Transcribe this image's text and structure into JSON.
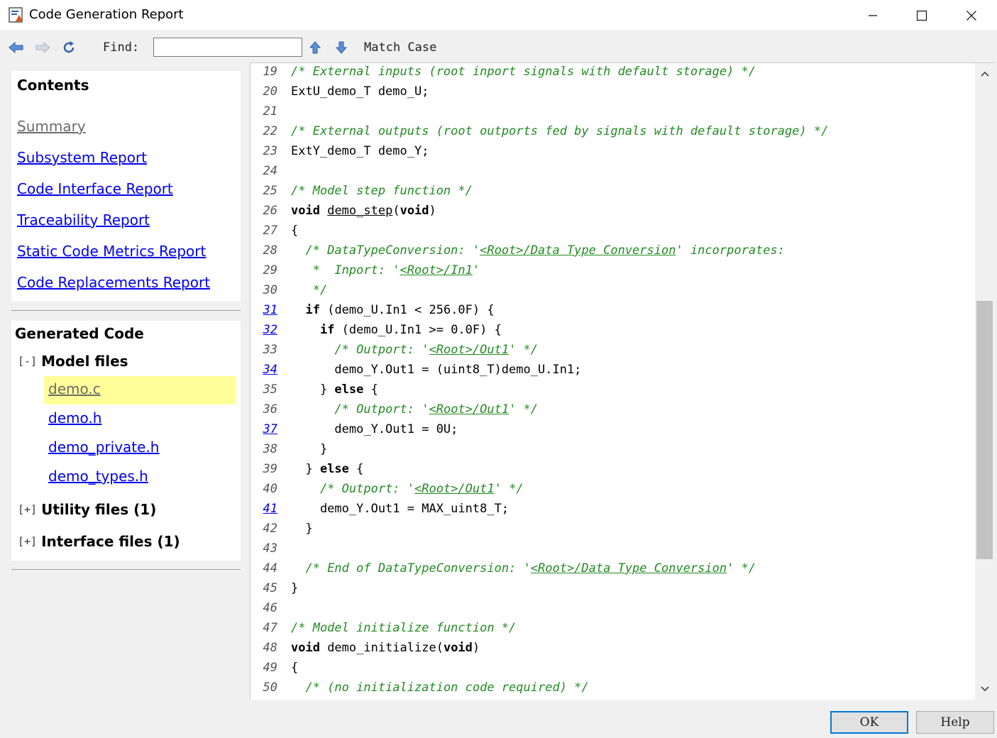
{
  "window": {
    "title": "Code Generation Report"
  },
  "toolbar": {
    "find_label": "Find:",
    "find_value": "",
    "match_case_label": "Match Case"
  },
  "contents": {
    "title": "Contents",
    "links": [
      {
        "label": "Summary",
        "visited": true
      },
      {
        "label": "Subsystem Report",
        "visited": false
      },
      {
        "label": "Code Interface Report",
        "visited": false
      },
      {
        "label": "Traceability Report",
        "visited": false
      },
      {
        "label": "Static Code Metrics Report",
        "visited": false
      },
      {
        "label": "Code Replacements Report",
        "visited": false
      }
    ]
  },
  "generated_code": {
    "title": "Generated Code",
    "groups": [
      {
        "toggle": "[-]",
        "label": "Model files",
        "files": [
          "demo.c",
          "demo.h",
          "demo_private.h",
          "demo_types.h"
        ],
        "selected_file": "demo.c"
      },
      {
        "toggle": "[+]",
        "label": "Utility files (1)",
        "files": []
      },
      {
        "toggle": "[+]",
        "label": "Interface files (1)",
        "files": []
      }
    ]
  },
  "code": {
    "file": "demo.c",
    "lines": [
      {
        "n": "19",
        "link": false,
        "parts": [
          [
            "c",
            "/* External inputs (root inport signals with default storage) */"
          ]
        ]
      },
      {
        "n": "20",
        "link": false,
        "parts": [
          [
            "t",
            "ExtU_demo_T demo_U;"
          ]
        ]
      },
      {
        "n": "21",
        "link": false,
        "parts": []
      },
      {
        "n": "22",
        "link": false,
        "parts": [
          [
            "c",
            "/* External outputs (root outports fed by signals with default storage) */"
          ]
        ]
      },
      {
        "n": "23",
        "link": false,
        "parts": [
          [
            "t",
            "ExtY_demo_T demo_Y;"
          ]
        ]
      },
      {
        "n": "24",
        "link": false,
        "parts": []
      },
      {
        "n": "25",
        "link": false,
        "parts": [
          [
            "c",
            "/* Model step function */"
          ]
        ]
      },
      {
        "n": "26",
        "link": false,
        "parts": [
          [
            "k",
            "void"
          ],
          [
            "t",
            " "
          ],
          [
            "f",
            "demo_step"
          ],
          [
            "t",
            "("
          ],
          [
            "k",
            "void"
          ],
          [
            "t",
            ")"
          ]
        ]
      },
      {
        "n": "27",
        "link": false,
        "parts": [
          [
            "t",
            "{"
          ]
        ]
      },
      {
        "n": "28",
        "link": false,
        "parts": [
          [
            "t",
            "  "
          ],
          [
            "c",
            "/* DataTypeConversion: '"
          ],
          [
            "cl",
            "<Root>/Data Type Conversion"
          ],
          [
            "c",
            "' incorporates:"
          ]
        ]
      },
      {
        "n": "29",
        "link": false,
        "parts": [
          [
            "t",
            "   "
          ],
          [
            "c",
            "*  Inport: '"
          ],
          [
            "cl",
            "<Root>/In1"
          ],
          [
            "c",
            "'"
          ]
        ]
      },
      {
        "n": "30",
        "link": false,
        "parts": [
          [
            "t",
            "   "
          ],
          [
            "c",
            "*/"
          ]
        ]
      },
      {
        "n": "31",
        "link": true,
        "parts": [
          [
            "t",
            "  "
          ],
          [
            "k",
            "if"
          ],
          [
            "t",
            " (demo_U.In1 < 256.0F) {"
          ]
        ]
      },
      {
        "n": "32",
        "link": true,
        "parts": [
          [
            "t",
            "    "
          ],
          [
            "k",
            "if"
          ],
          [
            "t",
            " (demo_U.In1 >= 0.0F) {"
          ]
        ]
      },
      {
        "n": "33",
        "link": false,
        "parts": [
          [
            "t",
            "      "
          ],
          [
            "c",
            "/* Outport: '"
          ],
          [
            "cl",
            "<Root>/Out1"
          ],
          [
            "c",
            "' */"
          ]
        ]
      },
      {
        "n": "34",
        "link": true,
        "parts": [
          [
            "t",
            "      demo_Y.Out1 = (uint8_T)demo_U.In1;"
          ]
        ]
      },
      {
        "n": "35",
        "link": false,
        "parts": [
          [
            "t",
            "    } "
          ],
          [
            "k",
            "else"
          ],
          [
            "t",
            " {"
          ]
        ]
      },
      {
        "n": "36",
        "link": false,
        "parts": [
          [
            "t",
            "      "
          ],
          [
            "c",
            "/* Outport: '"
          ],
          [
            "cl",
            "<Root>/Out1"
          ],
          [
            "c",
            "' */"
          ]
        ]
      },
      {
        "n": "37",
        "link": true,
        "parts": [
          [
            "t",
            "      demo_Y.Out1 = 0U;"
          ]
        ]
      },
      {
        "n": "38",
        "link": false,
        "parts": [
          [
            "t",
            "    }"
          ]
        ]
      },
      {
        "n": "39",
        "link": false,
        "parts": [
          [
            "t",
            "  } "
          ],
          [
            "k",
            "else"
          ],
          [
            "t",
            " {"
          ]
        ]
      },
      {
        "n": "40",
        "link": false,
        "parts": [
          [
            "t",
            "    "
          ],
          [
            "c",
            "/* Outport: '"
          ],
          [
            "cl",
            "<Root>/Out1"
          ],
          [
            "c",
            "' */"
          ]
        ]
      },
      {
        "n": "41",
        "link": true,
        "parts": [
          [
            "t",
            "    demo_Y.Out1 = MAX_uint8_T;"
          ]
        ]
      },
      {
        "n": "42",
        "link": false,
        "parts": [
          [
            "t",
            "  }"
          ]
        ]
      },
      {
        "n": "43",
        "link": false,
        "parts": []
      },
      {
        "n": "44",
        "link": false,
        "parts": [
          [
            "t",
            "  "
          ],
          [
            "c",
            "/* End of DataTypeConversion: '"
          ],
          [
            "cl",
            "<Root>/Data Type Conversion"
          ],
          [
            "c",
            "' */"
          ]
        ]
      },
      {
        "n": "45",
        "link": false,
        "parts": [
          [
            "t",
            "}"
          ]
        ]
      },
      {
        "n": "46",
        "link": false,
        "parts": []
      },
      {
        "n": "47",
        "link": false,
        "parts": [
          [
            "c",
            "/* Model initialize function */"
          ]
        ]
      },
      {
        "n": "48",
        "link": false,
        "parts": [
          [
            "k",
            "void"
          ],
          [
            "t",
            " demo_initialize("
          ],
          [
            "k",
            "void"
          ],
          [
            "t",
            ")"
          ]
        ]
      },
      {
        "n": "49",
        "link": false,
        "parts": [
          [
            "t",
            "{"
          ]
        ]
      },
      {
        "n": "50",
        "link": false,
        "parts": [
          [
            "t",
            "  "
          ],
          [
            "c",
            "/* (no initialization code required) */"
          ]
        ]
      }
    ]
  },
  "scroll": {
    "thumb_start_fraction": 0.363,
    "thumb_size_fraction": 0.437
  },
  "buttons": {
    "ok": "OK",
    "help": "Help"
  },
  "colors": {
    "comment": "#228b22",
    "link": "#0000ee",
    "visited_link": "#6b6b6b",
    "selection_highlight": "#ffff99",
    "scroll_thumb": "#c2c2c2"
  },
  "icons": {
    "app": "matlab-report-icon",
    "back": "back-arrow-icon",
    "forward": "forward-arrow-icon",
    "refresh": "refresh-icon",
    "find_prev": "arrow-up-icon",
    "find_next": "arrow-down-icon"
  }
}
